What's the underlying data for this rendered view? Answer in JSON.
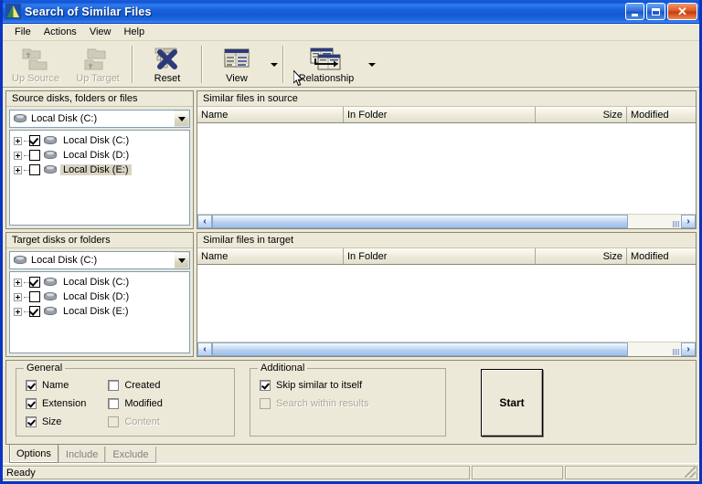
{
  "window": {
    "title": "Search of Similar Files",
    "app_icon": "triangle-app-icon",
    "caption": {
      "minimize": "minimize-icon",
      "maximize": "maximize-icon",
      "close": "close-icon",
      "close_glyph": "✕"
    },
    "accent_title_blue": "#0b34c4",
    "face_color": "#ece9d8"
  },
  "menu": {
    "items": [
      {
        "label": "File"
      },
      {
        "label": "Actions"
      },
      {
        "label": "View"
      },
      {
        "label": "Help"
      }
    ]
  },
  "toolbar": {
    "buttons": [
      {
        "label": "Up Source",
        "icon": "up-source-folder-icon",
        "enabled": false,
        "dropdown": false
      },
      {
        "label": "Up Target",
        "icon": "up-target-folder-icon",
        "enabled": false,
        "dropdown": false
      },
      {
        "label": "Reset",
        "icon": "reset-x-icon",
        "enabled": true,
        "dropdown": false
      },
      {
        "label": "View",
        "icon": "view-list-icon",
        "enabled": true,
        "dropdown": true
      },
      {
        "label": "Relationship",
        "icon": "relationship-windows-icon",
        "enabled": true,
        "dropdown": true
      }
    ]
  },
  "source_panel": {
    "header": "Source disks, folders or files",
    "combo_value": "Local Disk (C:)",
    "combo_icon": "drive-icon",
    "tree": [
      {
        "label": "Local Disk (C:)",
        "checked": true,
        "selected": false,
        "icon": "drive-icon"
      },
      {
        "label": "Local Disk (D:)",
        "checked": false,
        "selected": false,
        "icon": "drive-icon"
      },
      {
        "label": "Local Disk (E:)",
        "checked": false,
        "selected": true,
        "icon": "drive-icon"
      }
    ]
  },
  "target_panel": {
    "header": "Target disks or folders",
    "combo_value": "Local Disk (C:)",
    "combo_icon": "drive-icon",
    "tree": [
      {
        "label": "Local Disk (C:)",
        "checked": true,
        "selected": false,
        "icon": "drive-icon"
      },
      {
        "label": "Local Disk (D:)",
        "checked": false,
        "selected": false,
        "icon": "drive-icon"
      },
      {
        "label": "Local Disk (E:)",
        "checked": true,
        "selected": false,
        "icon": "drive-icon"
      }
    ]
  },
  "source_list": {
    "header": "Similar files in source",
    "columns": [
      "Name",
      "In Folder",
      "Size",
      "Modified"
    ],
    "rows": []
  },
  "target_list": {
    "header": "Similar files in target",
    "columns": [
      "Name",
      "In Folder",
      "Size",
      "Modified"
    ],
    "rows": []
  },
  "scroll": {
    "left_arrow": "‹",
    "right_arrow": "›"
  },
  "options": {
    "general": {
      "title": "General",
      "column1": [
        {
          "label": "Name",
          "checked": true,
          "enabled": true
        },
        {
          "label": "Extension",
          "checked": true,
          "enabled": true
        },
        {
          "label": "Size",
          "checked": true,
          "enabled": true
        }
      ],
      "column2": [
        {
          "label": "Created",
          "checked": false,
          "enabled": true
        },
        {
          "label": "Modified",
          "checked": false,
          "enabled": true
        },
        {
          "label": "Content",
          "checked": false,
          "enabled": false
        }
      ]
    },
    "additional": {
      "title": "Additional",
      "items": [
        {
          "label": "Skip similar to itself",
          "checked": true,
          "enabled": true
        },
        {
          "label": "Search within results",
          "checked": false,
          "enabled": false
        }
      ]
    },
    "start_button": "Start"
  },
  "tabs": [
    {
      "label": "Options",
      "active": true
    },
    {
      "label": "Include",
      "active": false
    },
    {
      "label": "Exclude",
      "active": false
    }
  ],
  "statusbar": {
    "message": "Ready",
    "pane2": "",
    "pane3": ""
  }
}
